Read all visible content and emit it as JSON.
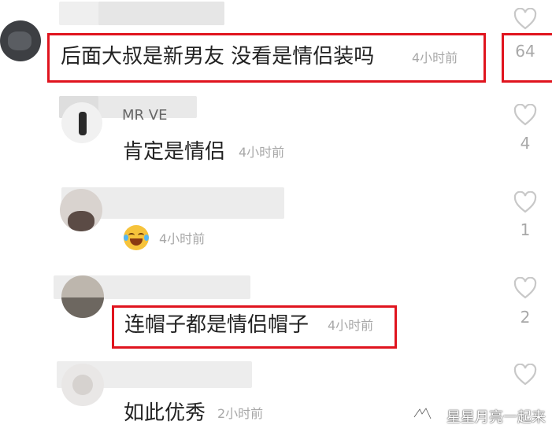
{
  "comments": [
    {
      "text": "后面大叔是新男友  没看是情侣装吗",
      "time": "4小时前",
      "likes": "64"
    },
    {
      "text": "肯定是情侣",
      "time": "4小时前",
      "likes": "4"
    },
    {
      "text": "",
      "time": "4小时前",
      "likes": "1",
      "emoji": "laughing-crying-emoji"
    },
    {
      "text": "连帽子都是情侣帽子",
      "time": "4小时前",
      "likes": "2"
    },
    {
      "text": "如此优秀",
      "time": "2小时前",
      "likes": ""
    }
  ],
  "partial_username": "MR VE",
  "watermark": "星星月亮一起来",
  "colors": {
    "highlight": "#e0141e",
    "muted": "#a8a8a8",
    "text": "#222222"
  }
}
